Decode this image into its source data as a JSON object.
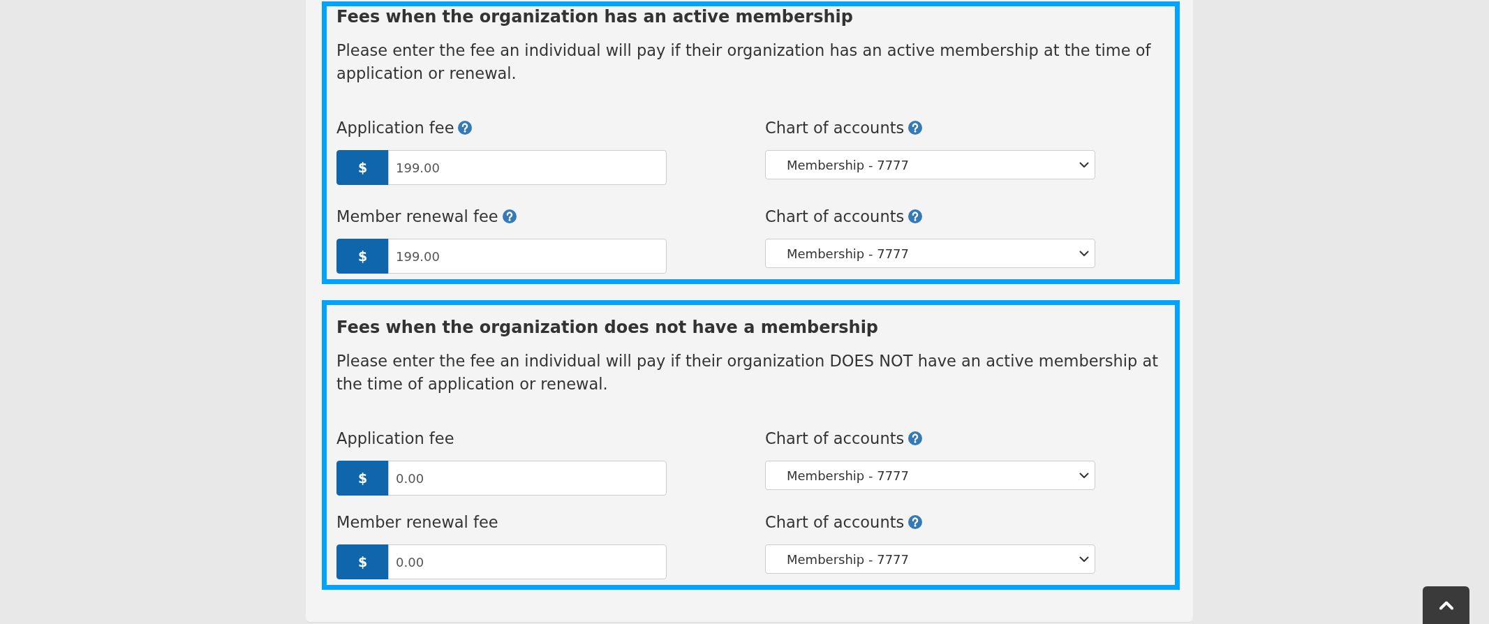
{
  "sections": [
    {
      "highlighted": true,
      "title": "Fees when the organization has an active membership",
      "description": "Please enter the fee an individual will pay if their organization has an active membership at the time of application or renewal.",
      "rows": [
        {
          "fee": {
            "label": "Application fee",
            "help": true,
            "prefix": "$",
            "value": "199.00"
          },
          "account": {
            "label": "Chart of accounts",
            "help": true,
            "value": "Membership - 7777"
          }
        },
        {
          "fee": {
            "label": "Member renewal fee",
            "help": true,
            "prefix": "$",
            "value": "199.00"
          },
          "account": {
            "label": "Chart of accounts",
            "help": true,
            "value": "Membership - 7777"
          }
        }
      ]
    },
    {
      "highlighted": true,
      "title": "Fees when the organization does not have a membership",
      "description": "Please enter the fee an individual will pay if their organization DOES NOT have an active membership at the time of application or renewal.",
      "rows": [
        {
          "fee": {
            "label": "Application fee",
            "help": false,
            "prefix": "$",
            "value": "0.00"
          },
          "account": {
            "label": "Chart of accounts",
            "help": true,
            "value": "Membership - 7777"
          }
        },
        {
          "fee": {
            "label": "Member renewal fee",
            "help": false,
            "prefix": "$",
            "value": "0.00"
          },
          "account": {
            "label": "Chart of accounts",
            "help": true,
            "value": "Membership - 7777"
          }
        }
      ]
    }
  ]
}
